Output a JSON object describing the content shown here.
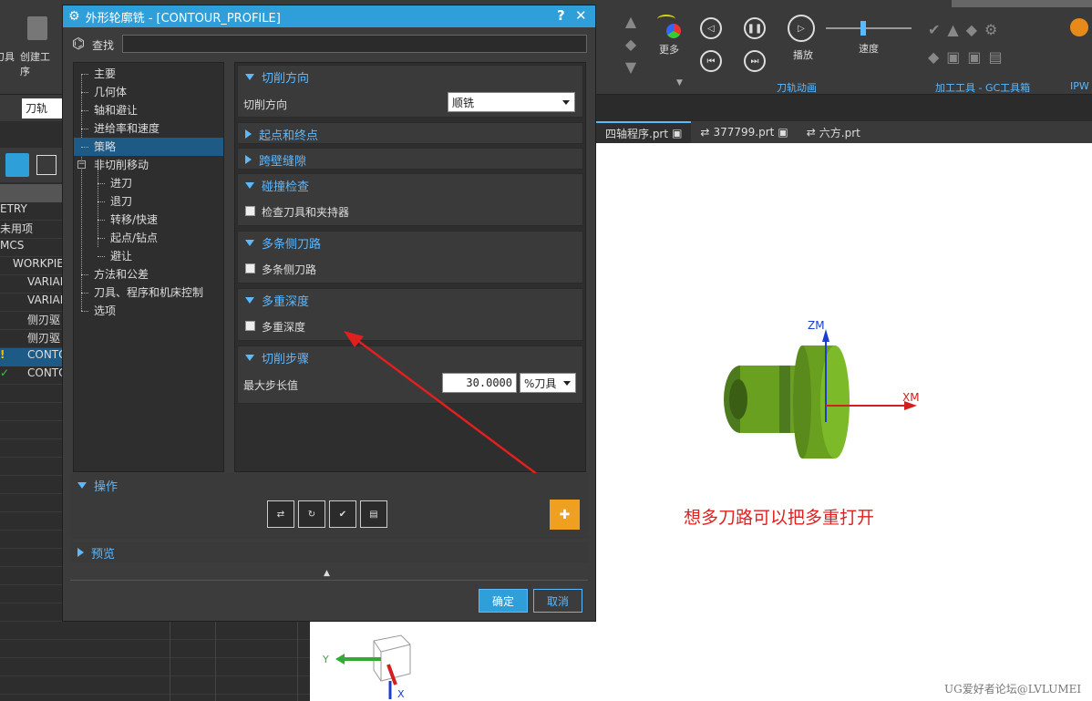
{
  "dialog": {
    "title": "外形轮廓铣 - [CONTOUR_PROFILE]",
    "help_label": "?",
    "close_label": "✕",
    "search_label": "查找",
    "search_value": "",
    "nav_items": [
      {
        "label": "主要"
      },
      {
        "label": "几何体"
      },
      {
        "label": "轴和避让"
      },
      {
        "label": "进给率和速度"
      },
      {
        "label": "策略"
      },
      {
        "label": "非切削移动"
      },
      {
        "label": "进刀"
      },
      {
        "label": "退刀"
      },
      {
        "label": "转移/快速"
      },
      {
        "label": "起点/钻点"
      },
      {
        "label": "避让"
      },
      {
        "label": "方法和公差"
      },
      {
        "label": "刀具、程序和机床控制"
      },
      {
        "label": "选项"
      }
    ],
    "selected_nav": "策略",
    "sections": {
      "cut_direction": {
        "title": "切削方向",
        "field_label": "切削方向",
        "value": "顺铣"
      },
      "start_end": {
        "title": "起点和终点"
      },
      "wall_gap": {
        "title": "跨壁缝隙"
      },
      "collision": {
        "title": "碰撞检查",
        "checkbox_label": "检查刀具和夹持器",
        "checked": false
      },
      "multi_side": {
        "title": "多条侧刀路",
        "checkbox_label": "多条侧刀路",
        "checked": false
      },
      "multi_depth": {
        "title": "多重深度",
        "checkbox_label": "多重深度",
        "checked": false
      },
      "step": {
        "title": "切削步骤",
        "field_label": "最大步长值",
        "value": "30.0000",
        "unit": "%刀具"
      }
    },
    "operations_title": "操作",
    "preview_title": "预览",
    "ok_label": "确定",
    "cancel_label": "取消"
  },
  "background": {
    "ribbon": {
      "left_labels": [
        "刀具",
        "创建工序"
      ],
      "more_label": "更多",
      "play_label": "播放",
      "speed_label": "速度",
      "group_anim": "刀轨动画",
      "group_tools": "加工工具 - GC工具箱",
      "group_ipw": "IPW"
    },
    "filter_value": "刀轨",
    "tree_rows": [
      "ETRY",
      "未用项",
      "MCS",
      "WORKPIE",
      "VARIAI",
      "VARIAI",
      "侧刃驱",
      "侧刃驱",
      "CONTO",
      "CONTO"
    ],
    "file_tabs": [
      "四轴程序.prt",
      "377799.prt",
      "六方.prt"
    ],
    "annotation_text": "想多刀路可以把多重打开",
    "axes": {
      "zm": "ZM",
      "xm": "XM",
      "y": "Y",
      "x": "X"
    },
    "watermark": "UG爱好者论坛@LVLUMEI"
  }
}
